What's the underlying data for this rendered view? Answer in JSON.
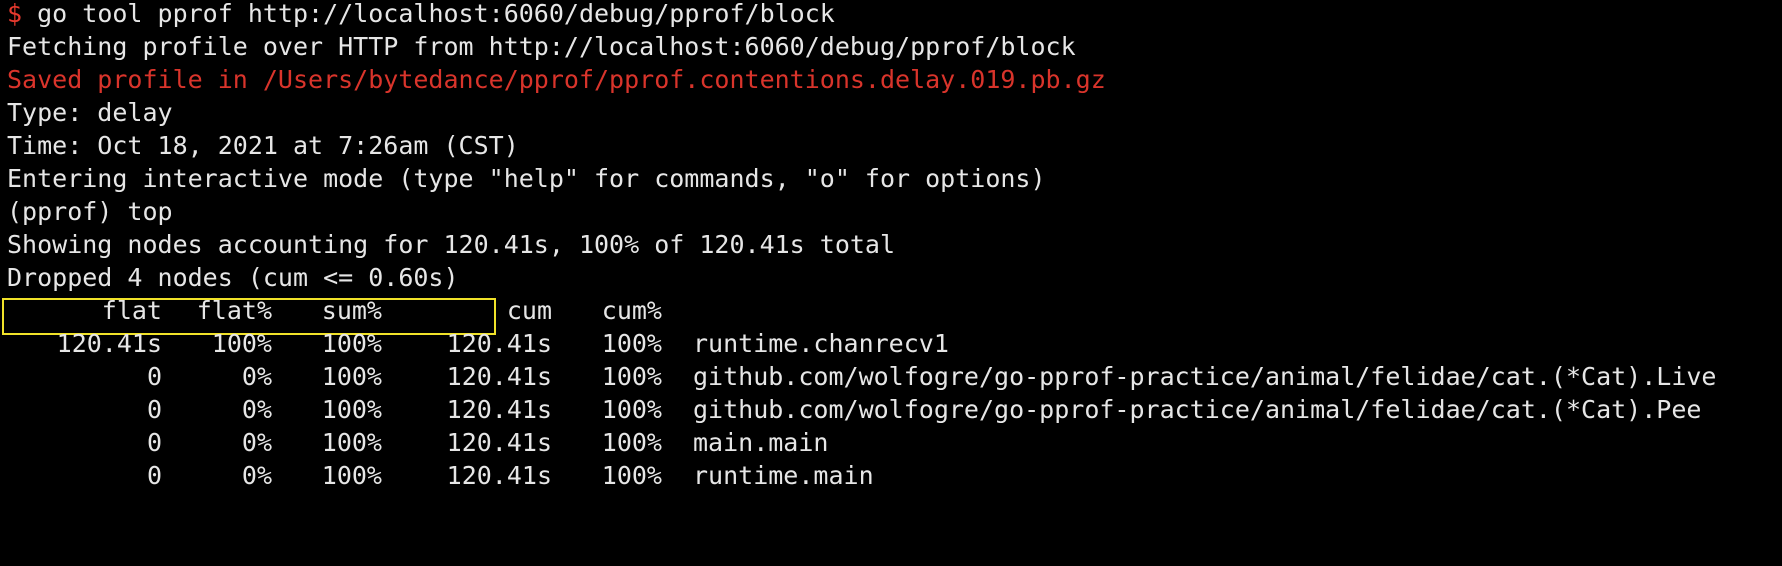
{
  "terminal": {
    "prompt_symbol": "$",
    "command": " go tool pprof http://localhost:6060/debug/pprof/block",
    "lines": {
      "fetching": "Fetching profile over HTTP from http://localhost:6060/debug/pprof/block",
      "saved": "Saved profile in /Users/bytedance/pprof/pprof.contentions.delay.019.pb.gz",
      "type": "Type: delay",
      "time": "Time: Oct 18, 2021 at 7:26am (CST)",
      "interactive": "Entering interactive mode (type \"help\" for commands, \"o\" for options)",
      "pprof_cmd": "(pprof) top",
      "showing": "Showing nodes accounting for 120.41s, 100% of 120.41s total",
      "dropped": "Dropped 4 nodes (cum <= 0.60s)"
    },
    "colors": {
      "background": "#000000",
      "text": "#e6e6e6",
      "error_red": "#d9342b",
      "highlight_box": "#f0e229"
    },
    "table": {
      "headers": {
        "flat": "flat",
        "flat_pct": "flat%",
        "sum_pct": "sum%",
        "cum": "cum",
        "cum_pct": "cum%"
      },
      "rows": [
        {
          "flat": "120.41s",
          "flat_pct": "100%",
          "sum_pct": "100%",
          "cum": "120.41s",
          "cum_pct": "100%",
          "func": "runtime.chanrecv1"
        },
        {
          "flat": "0",
          "flat_pct": "0%",
          "sum_pct": "100%",
          "cum": "120.41s",
          "cum_pct": "100%",
          "func": "github.com/wolfogre/go-pprof-practice/animal/felidae/cat.(*Cat).Live"
        },
        {
          "flat": "0",
          "flat_pct": "0%",
          "sum_pct": "100%",
          "cum": "120.41s",
          "cum_pct": "100%",
          "func": "github.com/wolfogre/go-pprof-practice/animal/felidae/cat.(*Cat).Pee"
        },
        {
          "flat": "0",
          "flat_pct": "0%",
          "sum_pct": "100%",
          "cum": "120.41s",
          "cum_pct": "100%",
          "func": "main.main"
        },
        {
          "flat": "0",
          "flat_pct": "0%",
          "sum_pct": "100%",
          "cum": "120.41s",
          "cum_pct": "100%",
          "func": "runtime.main"
        }
      ]
    }
  }
}
